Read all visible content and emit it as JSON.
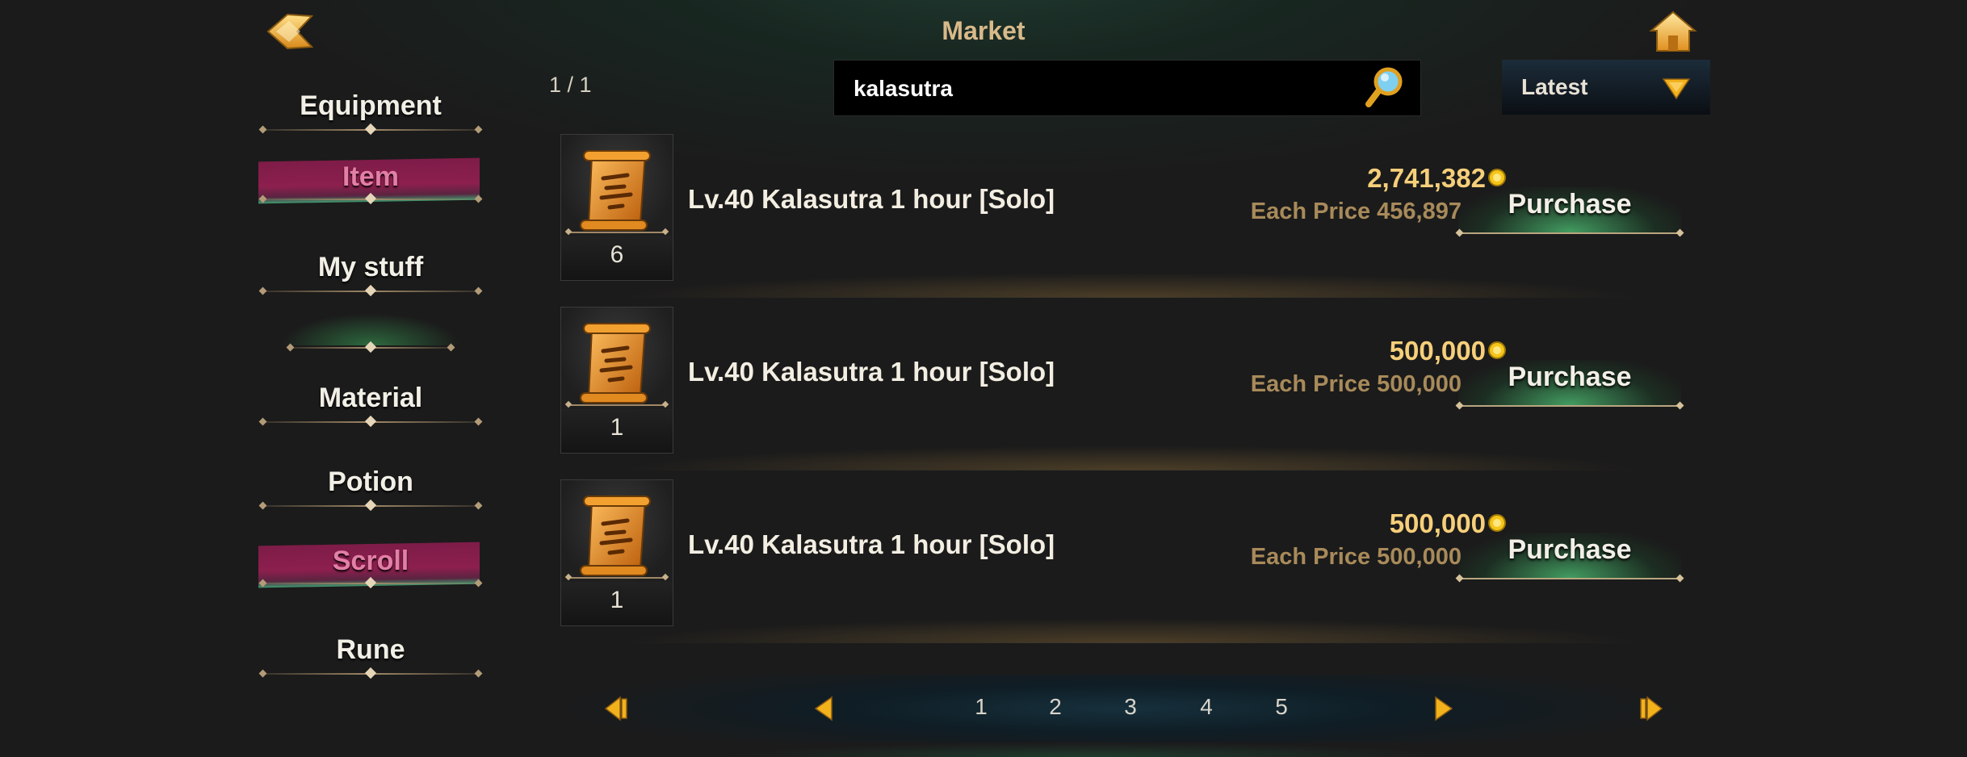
{
  "header": {
    "title": "Market",
    "back_icon": "back-arrow-icon",
    "home_icon": "home-icon"
  },
  "sidebar": {
    "items": [
      {
        "label": "Equipment",
        "active": false
      },
      {
        "label": "Item",
        "active": true
      },
      {
        "label": "My stuff",
        "active": false
      },
      {
        "label": "",
        "active": false
      },
      {
        "label": "Material",
        "active": false
      },
      {
        "label": "Potion",
        "active": false
      },
      {
        "label": "Scroll",
        "active": true
      },
      {
        "label": "Rune",
        "active": false
      }
    ]
  },
  "toolbar": {
    "page_indicator": "1 / 1",
    "search_value": "kalasutra",
    "sort_label": "Latest"
  },
  "listings": [
    {
      "name": "Lv.40 Kalasutra 1 hour [Solo]",
      "quantity": "6",
      "total_price": "2,741,382",
      "each_price": "Each Price 456,897",
      "button": "Purchase"
    },
    {
      "name": "Lv.40 Kalasutra 1 hour [Solo]",
      "quantity": "1",
      "total_price": "500,000",
      "each_price": "Each Price 500,000",
      "button": "Purchase"
    },
    {
      "name": "Lv.40 Kalasutra 1 hour [Solo]",
      "quantity": "1",
      "total_price": "500,000",
      "each_price": "Each Price 500,000",
      "button": "Purchase"
    }
  ],
  "pagination": {
    "pages": [
      "1",
      "2",
      "3",
      "4",
      "5"
    ]
  },
  "colors": {
    "accent_gold": "#f6cf7a",
    "active_tab": "#8c1f4e",
    "purchase_glow": "#50c878"
  }
}
